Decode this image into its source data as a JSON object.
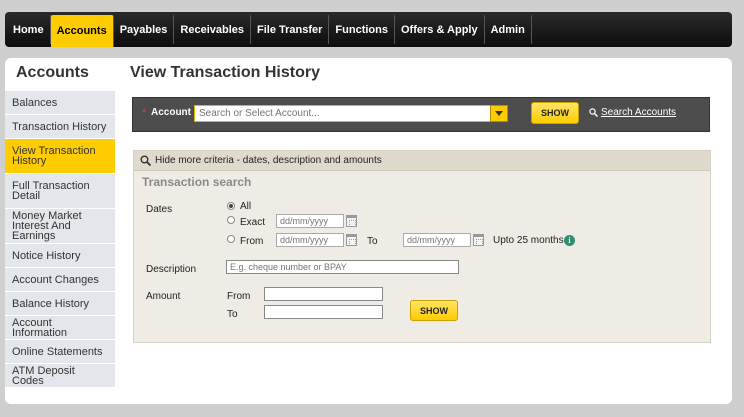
{
  "nav": {
    "items": [
      {
        "label": "Home",
        "active": false
      },
      {
        "label": "Accounts",
        "active": true
      },
      {
        "label": "Payables",
        "active": false
      },
      {
        "label": "Receivables",
        "active": false
      },
      {
        "label": "File Transfer",
        "active": false
      },
      {
        "label": "Functions",
        "active": false
      },
      {
        "label": "Offers & Apply",
        "active": false
      },
      {
        "label": "Admin",
        "active": false
      }
    ]
  },
  "sidebar": {
    "title": "Accounts",
    "items": [
      {
        "label": "Balances",
        "active": false
      },
      {
        "label": "Transaction History",
        "active": false
      },
      {
        "label": "View Transaction History",
        "active": true
      },
      {
        "label": "Full Transaction Detail",
        "active": false
      },
      {
        "label": "Money Market Interest And Earnings",
        "active": false
      },
      {
        "label": "Notice History",
        "active": false
      },
      {
        "label": "Account Changes",
        "active": false
      },
      {
        "label": "Balance History",
        "active": false
      },
      {
        "label": "Account Information",
        "active": false
      },
      {
        "label": "Online Statements",
        "active": false
      },
      {
        "label": "ATM Deposit Codes",
        "active": false
      }
    ]
  },
  "page": {
    "title": "View Transaction History"
  },
  "account_bar": {
    "required_mark": "*",
    "label": "Account",
    "placeholder": "Search or Select Account...",
    "show_label": "SHOW",
    "search_link": "Search Accounts"
  },
  "criteria": {
    "toggle_label": "Hide more criteria - dates, description and amounts",
    "section_title": "Transaction search",
    "dates_label": "Dates",
    "opt_all": "All",
    "opt_exact": "Exact",
    "opt_from": "From",
    "to_label": "To",
    "date_placeholder": "dd/mm/yyyy",
    "range_note": "Upto 25 months",
    "info_glyph": "i",
    "description_label": "Description",
    "description_placeholder": "E.g. cheque number or BPAY",
    "amount_label": "Amount",
    "amount_from_label": "From",
    "amount_to_label": "To",
    "show_label": "SHOW",
    "selected_date_option": "All"
  },
  "colors": {
    "accent": "#ffcc00",
    "nav_bg": "#111111",
    "sidebar_bg": "#e3e6ea"
  }
}
